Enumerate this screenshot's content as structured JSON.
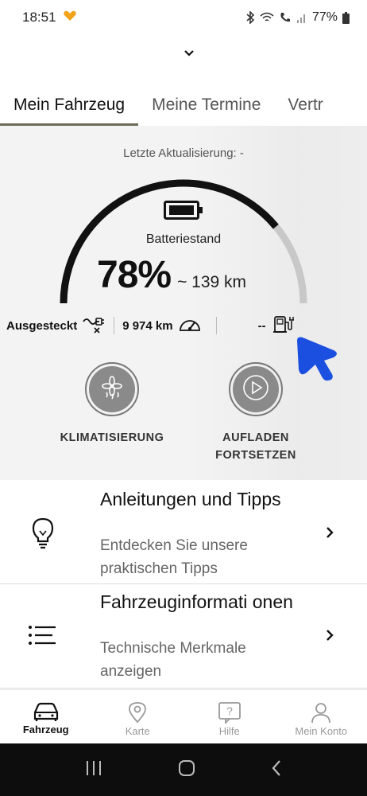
{
  "status_bar": {
    "time": "18:51",
    "battery_pct": "77%"
  },
  "tabs": [
    {
      "label": "Mein Fahrzeug",
      "active": true
    },
    {
      "label": "Meine Termine",
      "active": false
    },
    {
      "label": "Vertr",
      "active": false
    }
  ],
  "vehicle": {
    "last_update_label": "Letzte Aktualisierung:  -",
    "battery_label": "Batteriestand",
    "battery_percent": "78%",
    "battery_fraction": 0.78,
    "range": "~ 139 km",
    "plug_status": "Ausgesteckt",
    "odometer": "9 974 km",
    "charging_status": "--"
  },
  "actions": [
    {
      "label": "KLIMATISIERUNG",
      "icon": "climate-fan-icon"
    },
    {
      "label": "AUFLADEN FORTSETZEN",
      "icon": "play-icon"
    }
  ],
  "cards": [
    {
      "title": "Anleitungen und Tipps",
      "subtitle": "Entdecken Sie unsere praktischen Tipps",
      "icon": "lightbulb-icon"
    },
    {
      "title": "Fahrzeuginformati onen",
      "subtitle": "Technische Merkmale anzeigen",
      "icon": "list-icon"
    }
  ],
  "bottom_nav": [
    {
      "label": "Fahrzeug",
      "icon": "car-icon",
      "active": true
    },
    {
      "label": "Karte",
      "icon": "map-pin-icon",
      "active": false
    },
    {
      "label": "Hilfe",
      "icon": "help-icon",
      "active": false
    },
    {
      "label": "Mein Konto",
      "icon": "user-icon",
      "active": false
    }
  ],
  "colors": {
    "accent_underline": "#6b6b57",
    "cursor_blue": "#1a4fe0",
    "gauge_fill": "#111111",
    "gauge_track": "#c8c8c8"
  }
}
